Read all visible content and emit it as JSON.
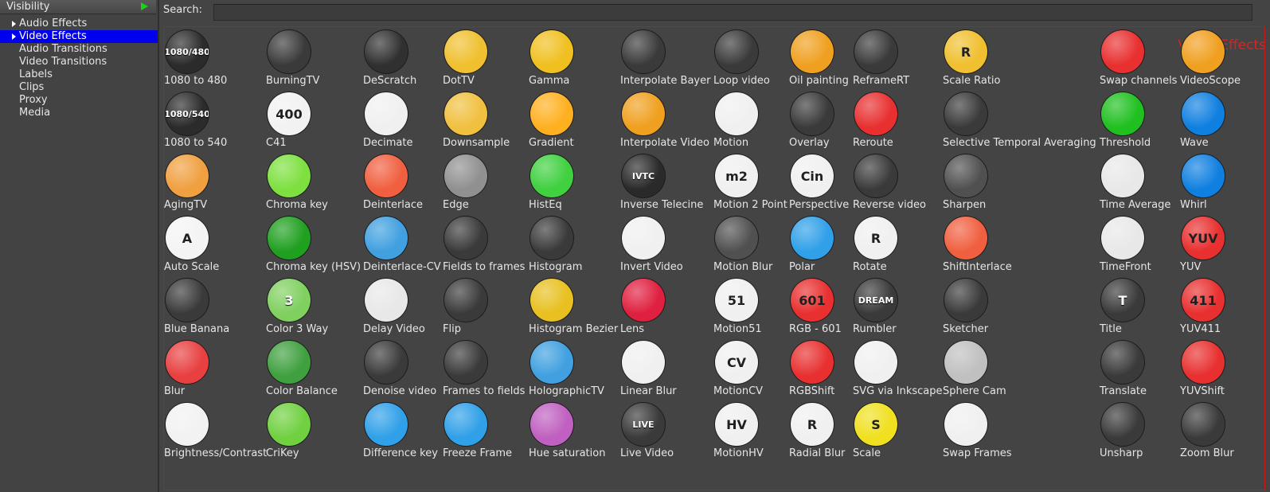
{
  "visibility": {
    "title": "Visibility"
  },
  "folders": [
    {
      "label": "Audio Effects",
      "selected": false,
      "expander": true
    },
    {
      "label": "Video Effects",
      "selected": true,
      "expander": true
    },
    {
      "label": "Audio Transitions",
      "selected": false,
      "expander": false
    },
    {
      "label": "Video Transitions",
      "selected": false,
      "expander": false
    },
    {
      "label": "Labels",
      "selected": false,
      "expander": false
    },
    {
      "label": "Clips",
      "selected": false,
      "expander": false
    },
    {
      "label": "Proxy",
      "selected": false,
      "expander": false
    },
    {
      "label": "Media",
      "selected": false,
      "expander": false
    }
  ],
  "search": {
    "label": "Search:",
    "value": ""
  },
  "overlay_text": "Video Effects",
  "columns": [
    [
      {
        "label": "1080 to 480",
        "icon": "1080-to-480-icon",
        "bg": "#2b2b2b",
        "text": "1080/480"
      },
      {
        "label": "1080 to 540",
        "icon": "1080-to-540-icon",
        "bg": "#2b2b2b",
        "text": "1080/540"
      },
      {
        "label": "AgingTV",
        "icon": "old-tv-icon",
        "bg": "#f0a040"
      },
      {
        "label": "Auto Scale",
        "icon": "auto-scale-icon",
        "bg": "#f4f4f4",
        "text": "A"
      },
      {
        "label": "Blue Banana",
        "icon": "banana-icon",
        "bg": "#3a3a3a"
      },
      {
        "label": "Blur",
        "icon": "blur-icon",
        "bg": "#e84040"
      },
      {
        "label": "Brightness/Contrast",
        "icon": "brightness-icon",
        "bg": "#f2f2f2"
      }
    ],
    [
      {
        "label": "BurningTV",
        "icon": "flame-icon",
        "bg": "#3a3a3a"
      },
      {
        "label": "C41",
        "icon": "film-roll-icon",
        "bg": "#f2f2f2",
        "text": "400"
      },
      {
        "label": "Chroma key",
        "icon": "chroma-key-icon",
        "bg": "#7ee040"
      },
      {
        "label": "Chroma key (HSV)",
        "icon": "chroma-key-hsv-icon",
        "bg": "#20a020"
      },
      {
        "label": "Color 3 Way",
        "icon": "color-3-way-icon",
        "bg": "#80d060",
        "text": "3"
      },
      {
        "label": "Color Balance",
        "icon": "color-balance-icon",
        "bg": "#40a040"
      },
      {
        "label": "CriKey",
        "icon": "kangaroo-icon",
        "bg": "#70d040"
      }
    ],
    [
      {
        "label": "DeScratch",
        "icon": "eraser-icon",
        "bg": "#303030"
      },
      {
        "label": "Decimate",
        "icon": "filmstrip-icon",
        "bg": "#f0f0f0"
      },
      {
        "label": "Deinterlace",
        "icon": "deinterlace-icon",
        "bg": "#f06040"
      },
      {
        "label": "Deinterlace-CV",
        "icon": "deinterlace-cv-icon",
        "bg": "#40a0e0"
      },
      {
        "label": "Delay Video",
        "icon": "stopwatch-snowflake-icon",
        "bg": "#e8e8e8"
      },
      {
        "label": "Denoise video",
        "icon": "denoise-icon",
        "bg": "#3a3a3a"
      },
      {
        "label": "Difference key",
        "icon": "difference-key-icon",
        "bg": "#30a0e8"
      }
    ],
    [
      {
        "label": "DotTV",
        "icon": "dot-tv-icon",
        "bg": "#f0c030"
      },
      {
        "label": "Downsample",
        "icon": "downsample-icon",
        "bg": "#f0c040"
      },
      {
        "label": "Edge",
        "icon": "edge-icon",
        "bg": "#909090"
      },
      {
        "label": "Fields to frames",
        "icon": "fields-to-frames-icon",
        "bg": "#3a3a3a"
      },
      {
        "label": "Flip",
        "icon": "flip-icon",
        "bg": "#3a3a3a"
      },
      {
        "label": "Frames to fields",
        "icon": "frames-to-fields-icon",
        "bg": "#3a3a3a"
      },
      {
        "label": "Freeze Frame",
        "icon": "snowflake-icon",
        "bg": "#30a0e8"
      }
    ],
    [
      {
        "label": "Gamma",
        "icon": "gamma-icon",
        "bg": "#f0c020"
      },
      {
        "label": "Gradient",
        "icon": "gradient-icon",
        "bg": "#ffb020"
      },
      {
        "label": "HistEq",
        "icon": "histeq-icon",
        "bg": "#40d040"
      },
      {
        "label": "Histogram",
        "icon": "histogram-icon",
        "bg": "#3a3a3a"
      },
      {
        "label": "Histogram Bezier",
        "icon": "histogram-bezier-icon",
        "bg": "#e8c020"
      },
      {
        "label": "HolographicTV",
        "icon": "holographic-tv-icon",
        "bg": "#40a0e0"
      },
      {
        "label": "Hue saturation",
        "icon": "hue-saturation-icon",
        "bg": "#c060c0"
      }
    ],
    [
      {
        "label": "Interpolate Bayer",
        "icon": "bayer-grid-icon",
        "bg": "#3a3a3a"
      },
      {
        "label": "Interpolate Video",
        "icon": "interpolate-video-icon",
        "bg": "#f0a020"
      },
      {
        "label": "Inverse Telecine",
        "icon": "ivtc-icon",
        "bg": "#2a2a2a",
        "text": "IVTC"
      },
      {
        "label": "Invert Video",
        "icon": "invert-video-icon",
        "bg": "#f0f0f0"
      },
      {
        "label": "Lens",
        "icon": "lens-icon",
        "bg": "#e02040"
      },
      {
        "label": "Linear Blur",
        "icon": "linear-blur-icon",
        "bg": "#f0f0f0"
      },
      {
        "label": "Live Video",
        "icon": "live-video-icon",
        "bg": "#3a3a3a",
        "text": "LIVE"
      }
    ],
    [
      {
        "label": "Loop video",
        "icon": "loop-icon",
        "bg": "#3a3a3a"
      },
      {
        "label": "Motion",
        "icon": "motion-camera-icon",
        "bg": "#f0f0f0"
      },
      {
        "label": "Motion 2 Point",
        "icon": "motion-2-point-icon",
        "bg": "#f0f0f0",
        "text": "m2"
      },
      {
        "label": "Motion Blur",
        "icon": "speedometer-icon",
        "bg": "#505050"
      },
      {
        "label": "Motion51",
        "icon": "motion51-icon",
        "bg": "#f0f0f0",
        "text": "51"
      },
      {
        "label": "MotionCV",
        "icon": "motioncv-icon",
        "bg": "#f0f0f0",
        "text": "CV"
      },
      {
        "label": "MotionHV",
        "icon": "motionhv-icon",
        "bg": "#f0f0f0",
        "text": "HV"
      }
    ],
    [
      {
        "label": "Oil painting",
        "icon": "oil-painting-icon",
        "bg": "#f0a020"
      },
      {
        "label": "Overlay",
        "icon": "overlay-icon",
        "bg": "#3a3a3a"
      },
      {
        "label": "Perspective",
        "icon": "perspective-icon",
        "bg": "#f0f0f0",
        "text": "Cin"
      },
      {
        "label": "Polar",
        "icon": "polar-bear-icon",
        "bg": "#30a0e8"
      },
      {
        "label": "RGB - 601",
        "icon": "rgb-601-icon",
        "bg": "#e83030",
        "text": "601"
      },
      {
        "label": "RGBShift",
        "icon": "rgb-shift-icon",
        "bg": "#e83030"
      },
      {
        "label": "Radial Blur",
        "icon": "radial-blur-icon",
        "bg": "#f0f0f0",
        "text": "R"
      }
    ],
    [
      {
        "label": "ReframeRT",
        "icon": "reframe-icon",
        "bg": "#3a3a3a"
      },
      {
        "label": "Reroute",
        "icon": "reroute-icon",
        "bg": "#e83030"
      },
      {
        "label": "Reverse video",
        "icon": "reverse-icon",
        "bg": "#3a3a3a"
      },
      {
        "label": "Rotate",
        "icon": "rotate-icon",
        "bg": "#f0f0f0",
        "text": "R"
      },
      {
        "label": "Rumbler",
        "icon": "rumbler-icon",
        "bg": "#3a3a3a",
        "text": "DREAM"
      },
      {
        "label": "SVG via Inkscape",
        "icon": "inkscape-icon",
        "bg": "#f0f0f0"
      },
      {
        "label": "Scale",
        "icon": "scale-icon",
        "bg": "#f0e020",
        "text": "S"
      }
    ],
    [
      {
        "label": "Scale Ratio",
        "icon": "scale-ratio-icon",
        "bg": "#f0c030",
        "text": "R"
      },
      {
        "label": "Selective Temporal Averaging",
        "icon": "selective-temporal-icon",
        "bg": "#3a3a3a"
      },
      {
        "label": "Sharpen",
        "icon": "sharpen-icon",
        "bg": "#505050"
      },
      {
        "label": "ShiftInterlace",
        "icon": "shift-interlace-icon",
        "bg": "#f06040"
      },
      {
        "label": "Sketcher",
        "icon": "sketcher-icon",
        "bg": "#3a3a3a"
      },
      {
        "label": "Sphere Cam",
        "icon": "sphere-cam-icon",
        "bg": "#c0c0c0"
      },
      {
        "label": "Swap Frames",
        "icon": "swap-frames-icon",
        "bg": "#f0f0f0"
      }
    ],
    [
      {
        "label": "Swap channels",
        "icon": "swap-channels-icon",
        "bg": "#e83030"
      },
      {
        "label": "Threshold",
        "icon": "threshold-icon",
        "bg": "#20c020"
      },
      {
        "label": "Time Average",
        "icon": "stopwatch-icon",
        "bg": "#e8e8e8"
      },
      {
        "label": "TimeFront",
        "icon": "timefront-icon",
        "bg": "#e8e8e8"
      },
      {
        "label": "Title",
        "icon": "title-icon",
        "bg": "#3a3a3a",
        "text": "T"
      },
      {
        "label": "Translate",
        "icon": "translate-arrows-icon",
        "bg": "#3a3a3a"
      },
      {
        "label": "Unsharp",
        "icon": "unsharp-icon",
        "bg": "#3a3a3a"
      }
    ],
    [
      {
        "label": "VideoScope",
        "icon": "videoscope-icon",
        "bg": "#f0a020"
      },
      {
        "label": "Wave",
        "icon": "wave-icon",
        "bg": "#1080e0"
      },
      {
        "label": "Whirl",
        "icon": "whirl-icon",
        "bg": "#1080e0"
      },
      {
        "label": "YUV",
        "icon": "yuv-icon",
        "bg": "#e83030",
        "text": "YUV"
      },
      {
        "label": "YUV411",
        "icon": "yuv411-icon",
        "bg": "#e83030",
        "text": "411"
      },
      {
        "label": "YUVShift",
        "icon": "yuv-shift-icon",
        "bg": "#e83030"
      },
      {
        "label": "Zoom Blur",
        "icon": "zoom-blur-icon",
        "bg": "#3a3a3a"
      }
    ]
  ]
}
